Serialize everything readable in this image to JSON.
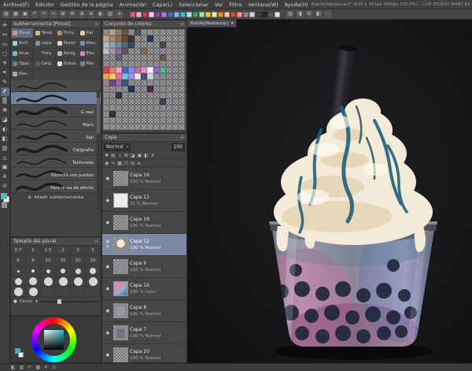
{
  "window": {
    "title": "Batido[Restaurar]* (615 x 501px 300dpi 150.0%) - CLIP STUDIO PAINT EX"
  },
  "menubar": {
    "items": [
      "Archivo(F)",
      "Edición",
      "Gestión de la página",
      "Animación",
      "Capa(L)",
      "Seleccionar",
      "Ver",
      "Filtro",
      "Ventana(W)",
      "Ayuda(H)"
    ]
  },
  "command_bar": {
    "icons": [
      {
        "name": "new-file-icon",
        "glyph": "▤"
      },
      {
        "name": "open-file-icon",
        "glyph": "▦"
      },
      {
        "name": "save-icon",
        "glyph": "▣"
      },
      {
        "name": "undo-icon",
        "glyph": "↶"
      },
      {
        "name": "redo-icon",
        "glyph": "↷"
      },
      {
        "name": "cut-icon",
        "glyph": "✂"
      },
      {
        "name": "copy-icon",
        "glyph": "⊞"
      },
      {
        "name": "paste-icon",
        "glyph": "⊟"
      },
      {
        "name": "zoom-in-icon",
        "glyph": "⊕"
      },
      {
        "name": "zoom-out-icon",
        "glyph": "⊖"
      },
      {
        "name": "rotate-view-icon",
        "glyph": "◐"
      },
      {
        "name": "grid-icon",
        "glyph": "▥"
      },
      {
        "name": "snap-icon",
        "glyph": "≡"
      }
    ],
    "swatches": [
      "#e85a8a",
      "#f2a6c4",
      "#c83a6a",
      "#f8d2e2",
      "#8a4a9c",
      "#b87ad8",
      "#4a6ad8",
      "#8ab0f0",
      "#3ab8d8",
      "#a2e8f2",
      "#3aa86a",
      "#a2e2b2",
      "#e8c83a",
      "#f8e8a2",
      "#e88a3a",
      "#f8c892",
      "#d84a3a",
      "#f29a8a",
      "#8a8a8a",
      "#d0d0d0",
      "#463a56",
      "#2a2a2e",
      "#6a5a4a",
      "#e8e0d2"
    ],
    "right_icons": [
      {
        "name": "ruler-icon",
        "glyph": "▥"
      },
      {
        "name": "material-icon",
        "glyph": "◨"
      },
      {
        "name": "reference-icon",
        "glyph": "⊡"
      },
      {
        "name": "flip-icon",
        "glyph": "◧"
      },
      {
        "name": "more-icon",
        "glyph": "⋯"
      }
    ]
  },
  "tools": {
    "main_color": "#3ec1d4",
    "sub_color": "#f2f2f2",
    "items": [
      {
        "name": "operation-tool",
        "glyph": "✛"
      },
      {
        "name": "move-tool",
        "glyph": "↔"
      },
      {
        "name": "selection-tool",
        "glyph": "▭"
      },
      {
        "name": "lasso-tool",
        "glyph": "○"
      },
      {
        "name": "magic-wand-tool",
        "glyph": "✳"
      },
      {
        "name": "pen-tool",
        "glyph": "✒"
      },
      {
        "name": "pencil-tool",
        "glyph": "✎"
      },
      {
        "name": "brush-tool",
        "glyph": "✐",
        "selected": true
      },
      {
        "name": "airbrush-tool",
        "glyph": "▒"
      },
      {
        "name": "decoration-tool",
        "glyph": "❋"
      },
      {
        "name": "eraser-tool",
        "glyph": "◪"
      },
      {
        "name": "blend-tool",
        "glyph": "◐"
      },
      {
        "name": "fill-tool",
        "glyph": "◧"
      },
      {
        "name": "gradient-tool",
        "glyph": "▨"
      },
      {
        "name": "figure-tool",
        "glyph": "△"
      },
      {
        "name": "frame-border-tool",
        "glyph": "▣"
      },
      {
        "name": "text-tool",
        "glyph": "A"
      },
      {
        "name": "balloon-tool",
        "glyph": "⊙"
      }
    ]
  },
  "subtool": {
    "title": "Subherramienta [Pincel]",
    "groups": [
      {
        "label": "Pincel",
        "color": "#c8a078",
        "selected": true
      },
      {
        "label": "Témp.",
        "color": "#d8b890"
      },
      {
        "label": "Pintu.",
        "color": "#b89068"
      },
      {
        "label": "Piel",
        "color": "#e8c8a8"
      },
      {
        "label": "Acríl.",
        "color": "#a8c8d8"
      },
      {
        "label": "Lápiz",
        "color": "#909090"
      },
      {
        "label": "Pastel",
        "color": "#e8d8c8"
      },
      {
        "label": "Marc.",
        "color": "#7890c8"
      },
      {
        "label": "Acua.",
        "color": "#78b8d8"
      },
      {
        "label": "Tinta",
        "color": "#3a4254"
      },
      {
        "label": "Aeróg.",
        "color": "#a8b8c8"
      },
      {
        "label": "Efec.",
        "color": "#c890b8"
      },
      {
        "label": "Opac.",
        "color": "#887868"
      },
      {
        "label": "Calig.",
        "color": "#585868"
      },
      {
        "label": "Nubes",
        "color": "#d8e0e8"
      },
      {
        "label": "Mar.",
        "color": "#6888a8"
      },
      {
        "label": "Efec.",
        "color": "#b8a8c8"
      }
    ],
    "brushes": [
      {
        "name": ""
      },
      {
        "name": "",
        "selected": true
      },
      {
        "name": "G real"
      },
      {
        "name": "Maru"
      },
      {
        "name": "Saji"
      },
      {
        "name": "Caligrafía"
      },
      {
        "name": "Texturado"
      },
      {
        "name": "Plumilla con puntas"
      },
      {
        "name": "Para línea de efecto"
      }
    ],
    "add_icon": "⊕",
    "add_label": "Añadir subherramienta"
  },
  "brushsize": {
    "title": "Tamaño del pincel",
    "rows": [
      {
        "kind": "num",
        "values": [
          "0.7",
          "1",
          "1.5",
          "2",
          "3",
          "5"
        ]
      },
      {
        "kind": "num",
        "values": [
          "6",
          "8",
          "10",
          "15",
          "20",
          "25"
        ]
      },
      {
        "kind": "dot",
        "values": [
          3,
          4,
          5,
          6,
          7,
          8
        ]
      },
      {
        "kind": "dot",
        "values": [
          9,
          10,
          11,
          12,
          13,
          14
        ]
      },
      {
        "kind": "dot",
        "values": [
          16,
          18
        ]
      }
    ],
    "footer_icon": "●",
    "footer_label": "Circul.",
    "footer_caret": "▾"
  },
  "color_wheel": {
    "current": "#2fb7c9"
  },
  "colorset": {
    "title": "Conjunto de colores",
    "menu_icon": "≡",
    "swatches": [
      [
        "#9a8878",
        "#b5a28c",
        "#8a7a6a",
        "#6a5846",
        "",
        "#44586c",
        "",
        "",
        "",
        "",
        "",
        "",
        ""
      ],
      [
        "#c2a890",
        "#a88868",
        "#886e50",
        "#664e3c",
        "#463426",
        "",
        "",
        "#2a3a52",
        "",
        "",
        "",
        "",
        ""
      ],
      [
        "#b2bac2",
        "#92a2b2",
        "#7288a2",
        "#526a82",
        "#324a62",
        "",
        "",
        "",
        "",
        "#4a4a5c",
        "",
        "",
        ""
      ],
      [
        "#c8b8c8",
        "#a892a8",
        "#887088",
        "#685068",
        "",
        "",
        "#886a58",
        "",
        "",
        "",
        "",
        "",
        ""
      ],
      [
        "",
        "",
        "#58687a",
        "",
        "",
        "",
        "",
        "",
        "",
        "#6e5a4a",
        "",
        "",
        ""
      ],
      [
        "",
        "",
        "",
        "",
        "",
        "",
        "",
        "",
        "",
        "",
        "",
        "",
        ""
      ],
      [
        "#d04848",
        "#e87c7c",
        "#f2a2ba",
        "#4868c8",
        "#7a92e8",
        "#c868a8",
        "#f28aca",
        "#f8f8f8",
        "#9268ca",
        "#52b884",
        "",
        "",
        ""
      ],
      [
        "#e8a848",
        "#f8ca68",
        "#e868a8",
        "#68cae8",
        "#aa8ae8",
        "#eaeaea",
        "#4a5268",
        "#cad2e8",
        "",
        "",
        "",
        "",
        ""
      ],
      [
        "",
        "#6a4a8a",
        "#8a6caa",
        "#3a5a7a",
        "",
        "",
        "",
        "",
        "",
        "",
        "",
        "",
        ""
      ],
      [
        "",
        "",
        "",
        "",
        "#1a3a5a",
        "",
        "",
        "#4a2a4a",
        "",
        "",
        "",
        "",
        ""
      ],
      [
        "",
        "",
        "#2a3a4a",
        "",
        "",
        "",
        "",
        "",
        "",
        "",
        "",
        "",
        ""
      ],
      [
        "",
        "",
        "",
        "",
        "",
        "",
        "",
        "",
        "",
        "#38465a",
        "",
        "",
        ""
      ],
      [
        "",
        "",
        "",
        "",
        "",
        "",
        "",
        "",
        "",
        "",
        "",
        "",
        ""
      ],
      [
        "",
        "#3a3040",
        "",
        "",
        "",
        "",
        "",
        "",
        "",
        "",
        "",
        "",
        ""
      ],
      [
        "",
        "",
        "",
        "",
        "",
        "",
        "",
        "",
        "",
        "",
        "",
        "",
        ""
      ],
      [
        "",
        "",
        "",
        "",
        "",
        "",
        "",
        "",
        "",
        "",
        "",
        "",
        ""
      ]
    ]
  },
  "layers_panel": {
    "title": "Capa",
    "blend_label": "Normal",
    "blend_caret": "▾",
    "opacity_value": "100",
    "toolbar1": [
      {
        "name": "new-layer-icon",
        "glyph": "✚"
      },
      {
        "name": "new-folder-icon",
        "glyph": "▤"
      },
      {
        "name": "transfer-down-icon",
        "glyph": "↓"
      },
      {
        "name": "combine-icon",
        "glyph": "⊞"
      },
      {
        "name": "mask-icon",
        "glyph": "◪"
      },
      {
        "name": "ruler-layer-icon",
        "glyph": "▣"
      },
      {
        "name": "clip-icon",
        "glyph": "◧"
      },
      {
        "name": "delete-layer-icon",
        "glyph": "✕"
      }
    ],
    "toolbar2": [
      {
        "name": "show-all-icon",
        "glyph": "◉"
      },
      {
        "name": "edit-target-icon",
        "glyph": "✎"
      },
      {
        "name": "raster-icon",
        "glyph": "▦"
      },
      {
        "name": "lock-icon",
        "glyph": "⊡"
      },
      {
        "name": "lock-alpha-icon",
        "glyph": "⊟"
      },
      {
        "name": "palette-menu-icon",
        "glyph": "≡"
      }
    ],
    "layers": [
      {
        "name": "Capa 16",
        "info": "100 % Normal",
        "thumb": "empty"
      },
      {
        "name": "Capa 11",
        "info": "25 % Normal",
        "thumb": "white"
      },
      {
        "name": "Capa 19",
        "info": "100 % Normal",
        "thumb": "empty"
      },
      {
        "name": "Capa 12",
        "info": "100 % Normal",
        "thumb": "cream",
        "selected": true
      },
      {
        "name": "Capa 9",
        "info": "100 % Normal",
        "thumb": "sketch"
      },
      {
        "name": "Capa 10",
        "info": "100 % Color",
        "thumb": "color"
      },
      {
        "name": "Capa 8",
        "info": "100 % Normal",
        "thumb": "cup"
      },
      {
        "name": "Capa 7",
        "info": "100 % Normal",
        "thumb": "cup2"
      },
      {
        "name": "Capa 20",
        "info": "100 % Normal",
        "thumb": "empty"
      }
    ]
  },
  "canvas": {
    "tab_label": "Batido[Restaurar]",
    "tab_caret": "▾"
  },
  "statusbar": {
    "icons": [
      {
        "name": "fg-bg-icon",
        "glyph": "◧"
      },
      {
        "name": "palette-icon",
        "glyph": "▥"
      },
      {
        "name": "history-icon",
        "glyph": "↶"
      },
      {
        "name": "grid-icon",
        "glyph": "▦"
      },
      {
        "name": "navigate-icon",
        "glyph": "✛"
      },
      {
        "name": "info-icon",
        "glyph": "⊙"
      }
    ]
  },
  "artwork": {
    "colors": {
      "background": "#141416",
      "cream": "#f3ead7",
      "cream_shadow": "#dcc9a4",
      "syrup": "#1e607a",
      "syrup_dark": "#174355",
      "cup_pink": "#c06a96",
      "cup_magenta": "#8a4a72",
      "cup_blue": "#5a6ab0",
      "boba": "#20283a",
      "straw": "#26262c"
    }
  }
}
